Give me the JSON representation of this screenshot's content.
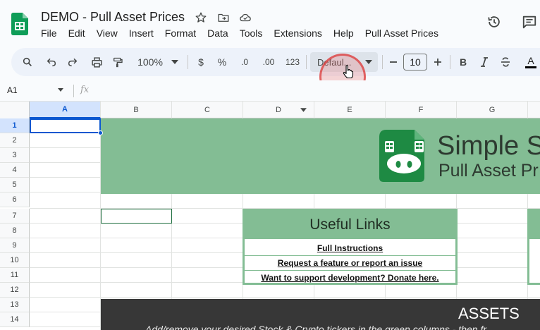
{
  "header": {
    "doc_title": "DEMO - Pull Asset Prices",
    "menu": [
      "File",
      "Edit",
      "View",
      "Insert",
      "Format",
      "Data",
      "Tools",
      "Extensions",
      "Help",
      "Pull Asset Prices"
    ]
  },
  "toolbar": {
    "zoom": "100%",
    "currency": "$",
    "percent": "%",
    "decrease_decimal": ".0",
    "increase_decimal": ".00",
    "number_format": "123",
    "font": "Defaul...",
    "font_size": "10",
    "bold": "B",
    "text_color_glyph": "A"
  },
  "formula_bar": {
    "cell_ref": "A1",
    "fx": "fx"
  },
  "grid": {
    "columns": [
      "A",
      "B",
      "C",
      "D",
      "E",
      "F",
      "G"
    ],
    "rows": [
      "1",
      "2",
      "3",
      "4",
      "5",
      "6",
      "7",
      "8",
      "9",
      "10",
      "11",
      "12",
      "13",
      "14"
    ],
    "selected_cell": "A1"
  },
  "banner": {
    "title": "Simple S",
    "subtitle": "Pull Asset Pr"
  },
  "useful_links": {
    "heading": "Useful Links",
    "links": [
      "Full Instructions",
      "Request a feature or report an issue",
      "Want to support development? Donate here."
    ]
  },
  "assets": {
    "title": "ASSETS",
    "subtitle": "Add/remove your desired Stock & Crypto tickers in the green columns - then fr"
  },
  "colors": {
    "banner_green": "#83bd94",
    "assets_bg": "#373737",
    "selection_blue": "#0b57d0"
  }
}
